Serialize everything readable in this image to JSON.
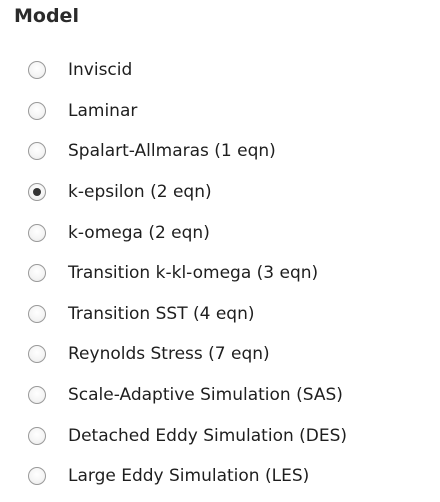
{
  "group": {
    "title": "Model",
    "options": [
      {
        "label": "Inviscid",
        "selected": false
      },
      {
        "label": "Laminar",
        "selected": false
      },
      {
        "label": "Spalart-Allmaras (1 eqn)",
        "selected": false
      },
      {
        "label": "k-epsilon (2 eqn)",
        "selected": true
      },
      {
        "label": "k-omega (2 eqn)",
        "selected": false
      },
      {
        "label": "Transition k-kl-omega (3 eqn)",
        "selected": false
      },
      {
        "label": "Transition SST (4 eqn)",
        "selected": false
      },
      {
        "label": "Reynolds Stress (7 eqn)",
        "selected": false
      },
      {
        "label": "Scale-Adaptive Simulation (SAS)",
        "selected": false
      },
      {
        "label": "Detached Eddy Simulation (DES)",
        "selected": false
      },
      {
        "label": "Large Eddy Simulation (LES)",
        "selected": false
      }
    ]
  }
}
